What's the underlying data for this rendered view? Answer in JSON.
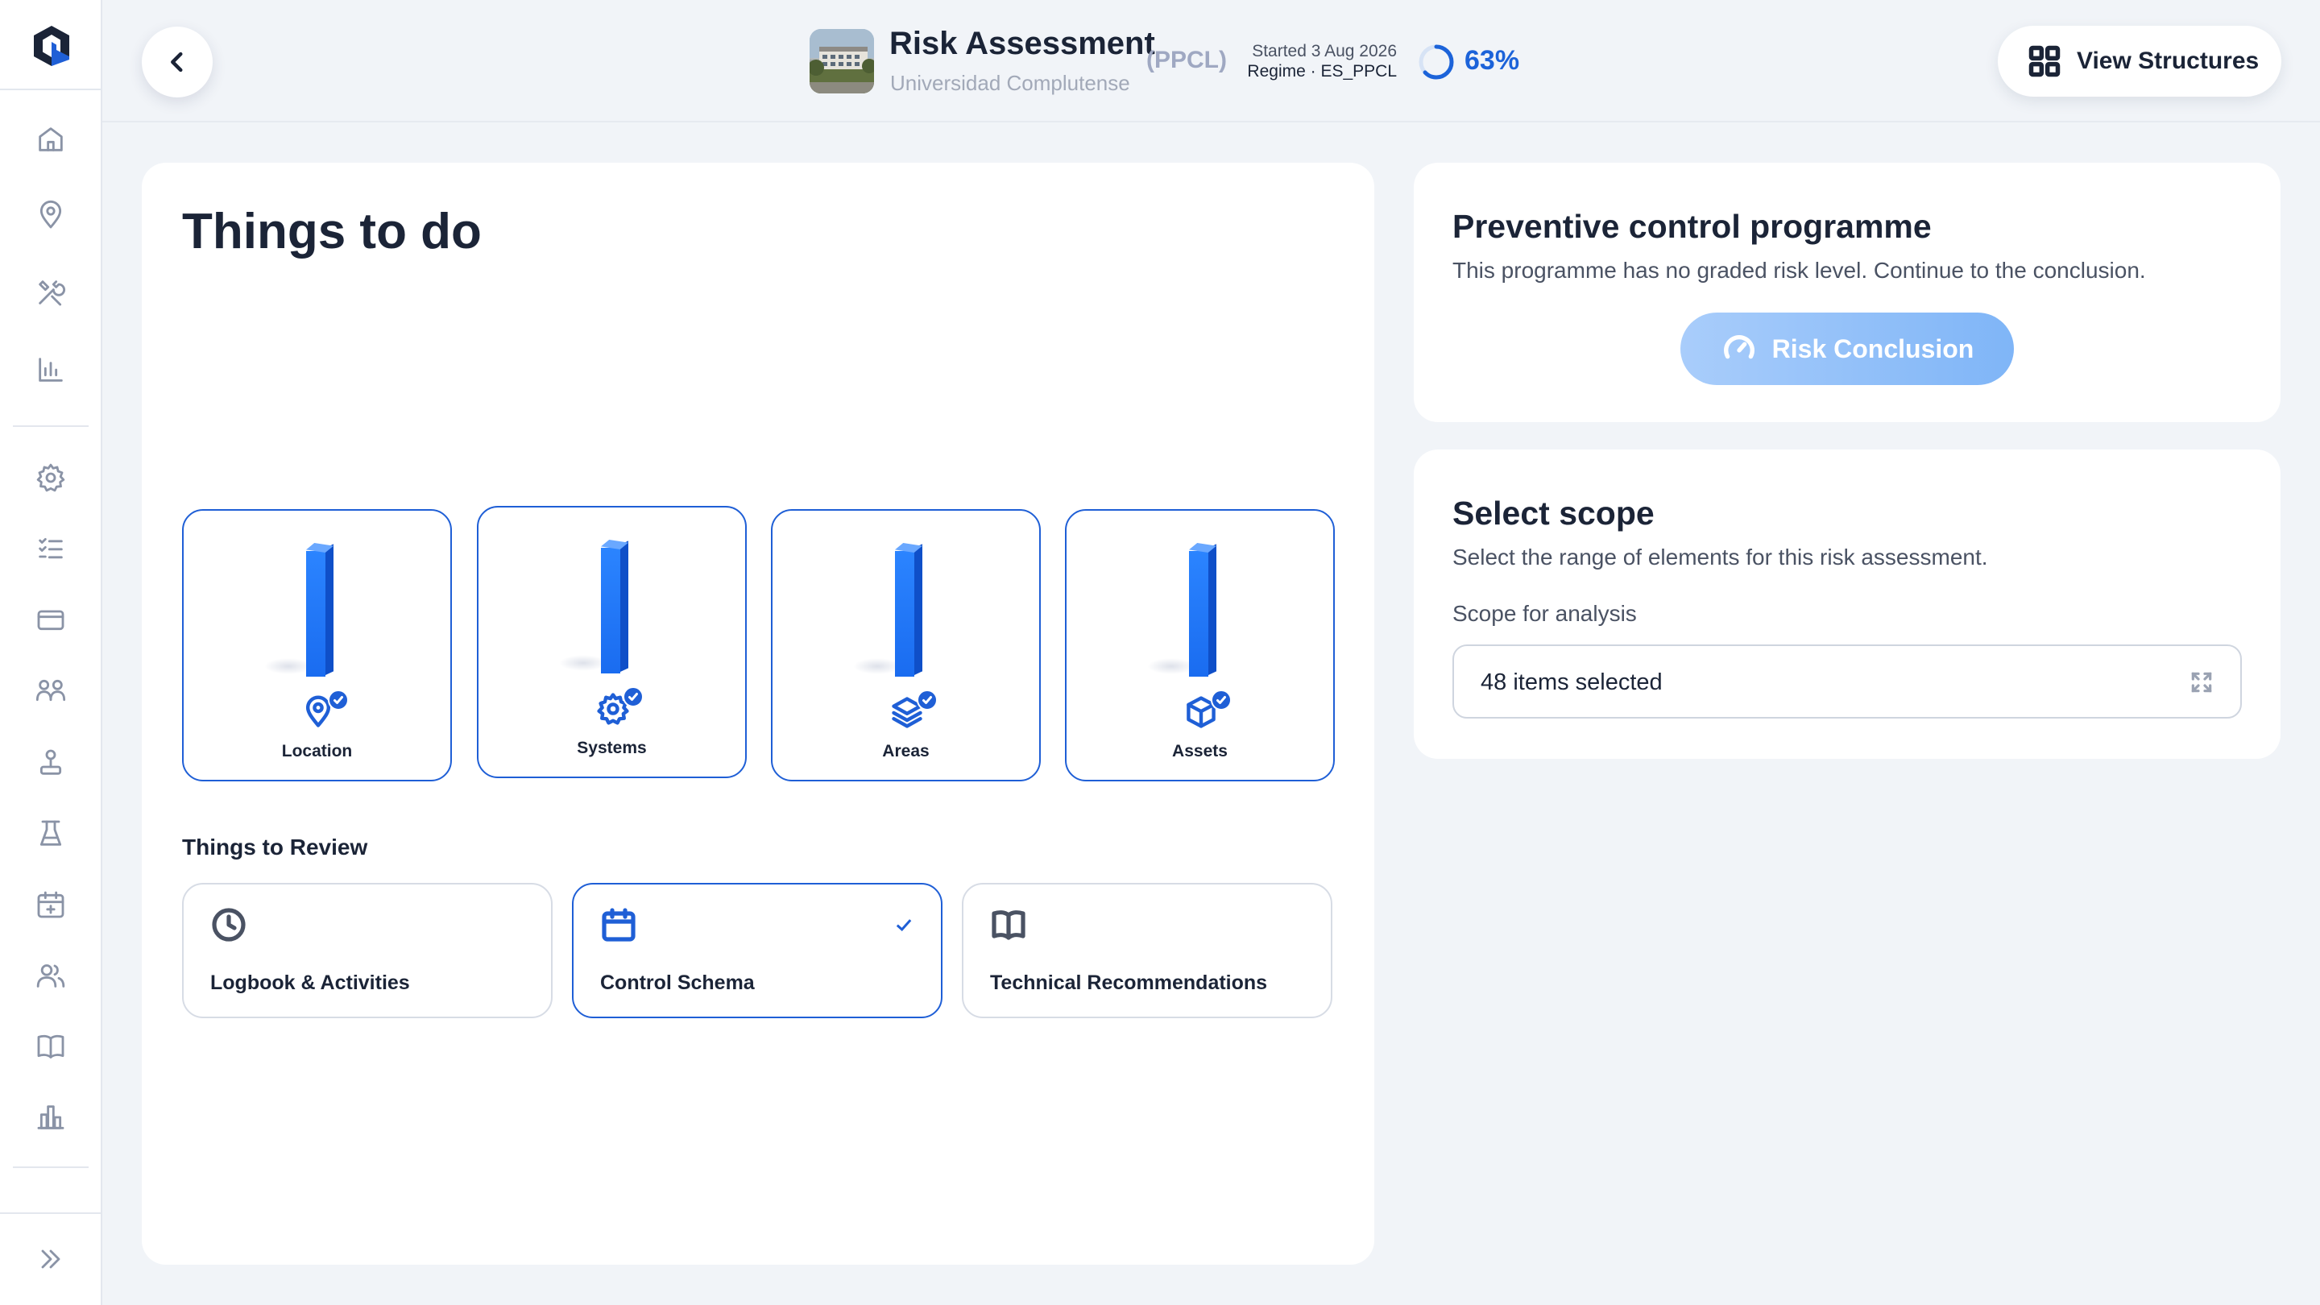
{
  "header": {
    "title": "Risk Assessment",
    "subtitle": "Universidad Complutense",
    "code": "(PPCL)",
    "started": "Started 3 Aug 2026",
    "regime": "Regime · ES_PPCL",
    "progress": "63%",
    "progress_value": 0.63,
    "view_structures_label": "View Structures"
  },
  "sidebar": {
    "items": [
      "home-icon",
      "location-pin-icon",
      "tools-icon",
      "chart-icon",
      "gear-icon",
      "checklist-icon",
      "card-icon",
      "people-group-icon",
      "joystick-icon",
      "lab-flask-icon",
      "calendar-add-icon",
      "users-icon",
      "book-icon",
      "building-chart-icon"
    ],
    "collapse_icon": "double-chevron-right-icon"
  },
  "things_to_do": {
    "heading": "Things to do",
    "cards": [
      {
        "label": "Location",
        "icon": "location-pin-icon",
        "completed": true
      },
      {
        "label": "Systems",
        "icon": "gear-icon",
        "completed": true
      },
      {
        "label": "Areas",
        "icon": "layers-icon",
        "completed": true
      },
      {
        "label": "Assets",
        "icon": "cube-icon",
        "completed": true
      }
    ]
  },
  "things_to_review": {
    "heading": "Things to Review",
    "items": [
      {
        "label": "Logbook & Activities",
        "icon": "clock-icon",
        "selected": false
      },
      {
        "label": "Control Schema",
        "icon": "calendar-icon",
        "selected": true
      },
      {
        "label": "Technical Recommendations",
        "icon": "book-icon",
        "selected": false
      }
    ]
  },
  "preventive": {
    "title": "Preventive control programme",
    "description": "This programme has no graded risk level. Continue to the conclusion.",
    "button_label": "Risk Conclusion"
  },
  "scope": {
    "title": "Select scope",
    "description": "Select the range of elements for this risk assessment.",
    "field_label": "Scope for analysis",
    "field_value": "48 items selected"
  },
  "colors": {
    "accent": "#1f5fd6",
    "background": "#f1f4f8",
    "button_light": "#8fbef8"
  }
}
